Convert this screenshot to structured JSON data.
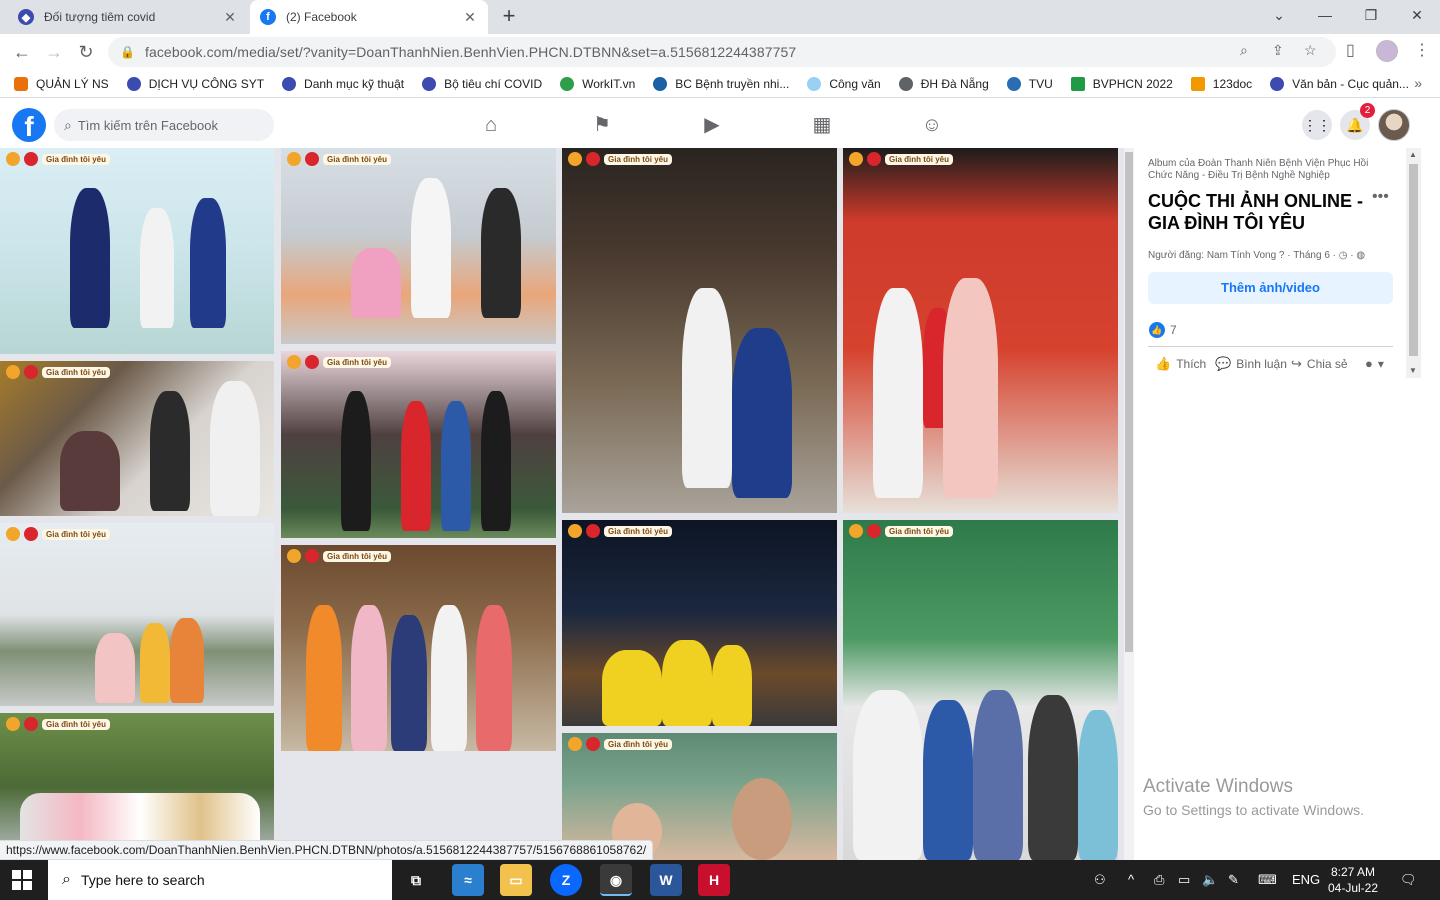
{
  "browser": {
    "tabs": [
      {
        "title": "Đối tượng tiêm covid",
        "active": false
      },
      {
        "title": "(2) Facebook",
        "active": true
      }
    ],
    "url": "facebook.com/media/set/?vanity=DoanThanhNien.BenhVien.PHCN.DTBNN&set=a.5156812244387757",
    "bookmarks": [
      "QUẢN LÝ NS",
      "DỊCH VỤ CÔNG SYT",
      "Danh mục kỹ thuật",
      "Bộ tiêu chí COVID",
      "WorkIT.vn",
      "BC Bệnh truyền nhi...",
      "Công văn",
      "ĐH Đà Nẵng",
      "TVU",
      "BVPHCN 2022",
      "123doc",
      "Văn bản - Cục quản..."
    ],
    "status_url": "https://www.facebook.com/DoanThanhNien.BenhVien.PHCN.DTBNN/photos/a.5156812244387757/5156768861058762/"
  },
  "fb": {
    "search_placeholder": "Tìm kiếm trên Facebook",
    "notifications_count": "2",
    "sticker_text": "Gia đình tôi yêu"
  },
  "panel": {
    "album_of": "Album của Đoàn Thanh Niên Bệnh Viện Phục Hồi Chức Năng - Điều Trị Bệnh Nghề Nghiệp",
    "title": "CUỘC THI ẢNH ONLINE - GIA ĐÌNH TÔI YÊU",
    "posted_by": "Người đăng: Nam Tính Vong",
    "date": "Tháng 6",
    "add_button": "Thêm ảnh/video",
    "like_count": "7",
    "actions": {
      "like": "Thích",
      "comment": "Bình luận",
      "share": "Chia sẻ"
    },
    "watermark_title": "Activate Windows",
    "watermark_sub": "Go to Settings to activate Windows."
  },
  "taskbar": {
    "search_text": "Type here to search",
    "lang": "ENG",
    "time": "8:27 AM",
    "date": "04-Jul-22"
  },
  "colors": {
    "fb_blue": "#1877f2",
    "taskbar": "#1f1f1f"
  }
}
